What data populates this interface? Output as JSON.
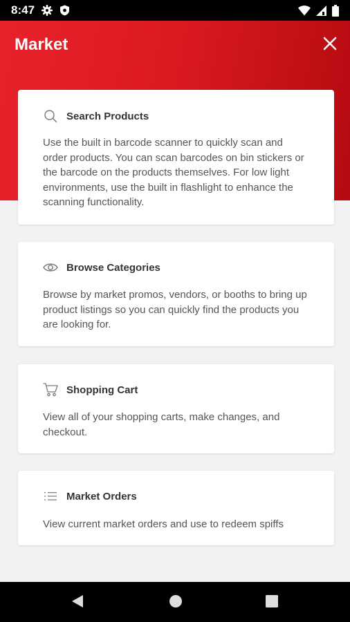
{
  "status_bar": {
    "time": "8:47",
    "left_icons": [
      "gear-icon",
      "shield-icon"
    ],
    "right_icons": [
      "wifi-icon",
      "signal-icon",
      "battery-icon"
    ]
  },
  "header": {
    "title": "Market",
    "close_icon": "close-icon",
    "color_start": "#e8222b",
    "color_end": "#b50a10"
  },
  "cards": [
    {
      "icon": "search-icon",
      "title": "Search Products",
      "description": "Use the built in barcode scanner to quickly scan and order products. You can scan barcodes on bin stickers or the barcode on the products themselves. For low light environments, use the built in flashlight to enhance the scanning functionality."
    },
    {
      "icon": "eye-icon",
      "title": "Browse Categories",
      "description": "Browse by market promos, vendors, or booths to bring up product listings so you can quickly find the products you are looking for."
    },
    {
      "icon": "cart-icon",
      "title": "Shopping Cart",
      "description": "View all of your shopping carts, make changes, and checkout."
    },
    {
      "icon": "list-icon",
      "title": "Market Orders",
      "description": "View current market orders and use to redeem spiffs"
    }
  ],
  "nav_bar": {
    "buttons": [
      "back-icon",
      "home-icon",
      "recents-icon"
    ]
  }
}
